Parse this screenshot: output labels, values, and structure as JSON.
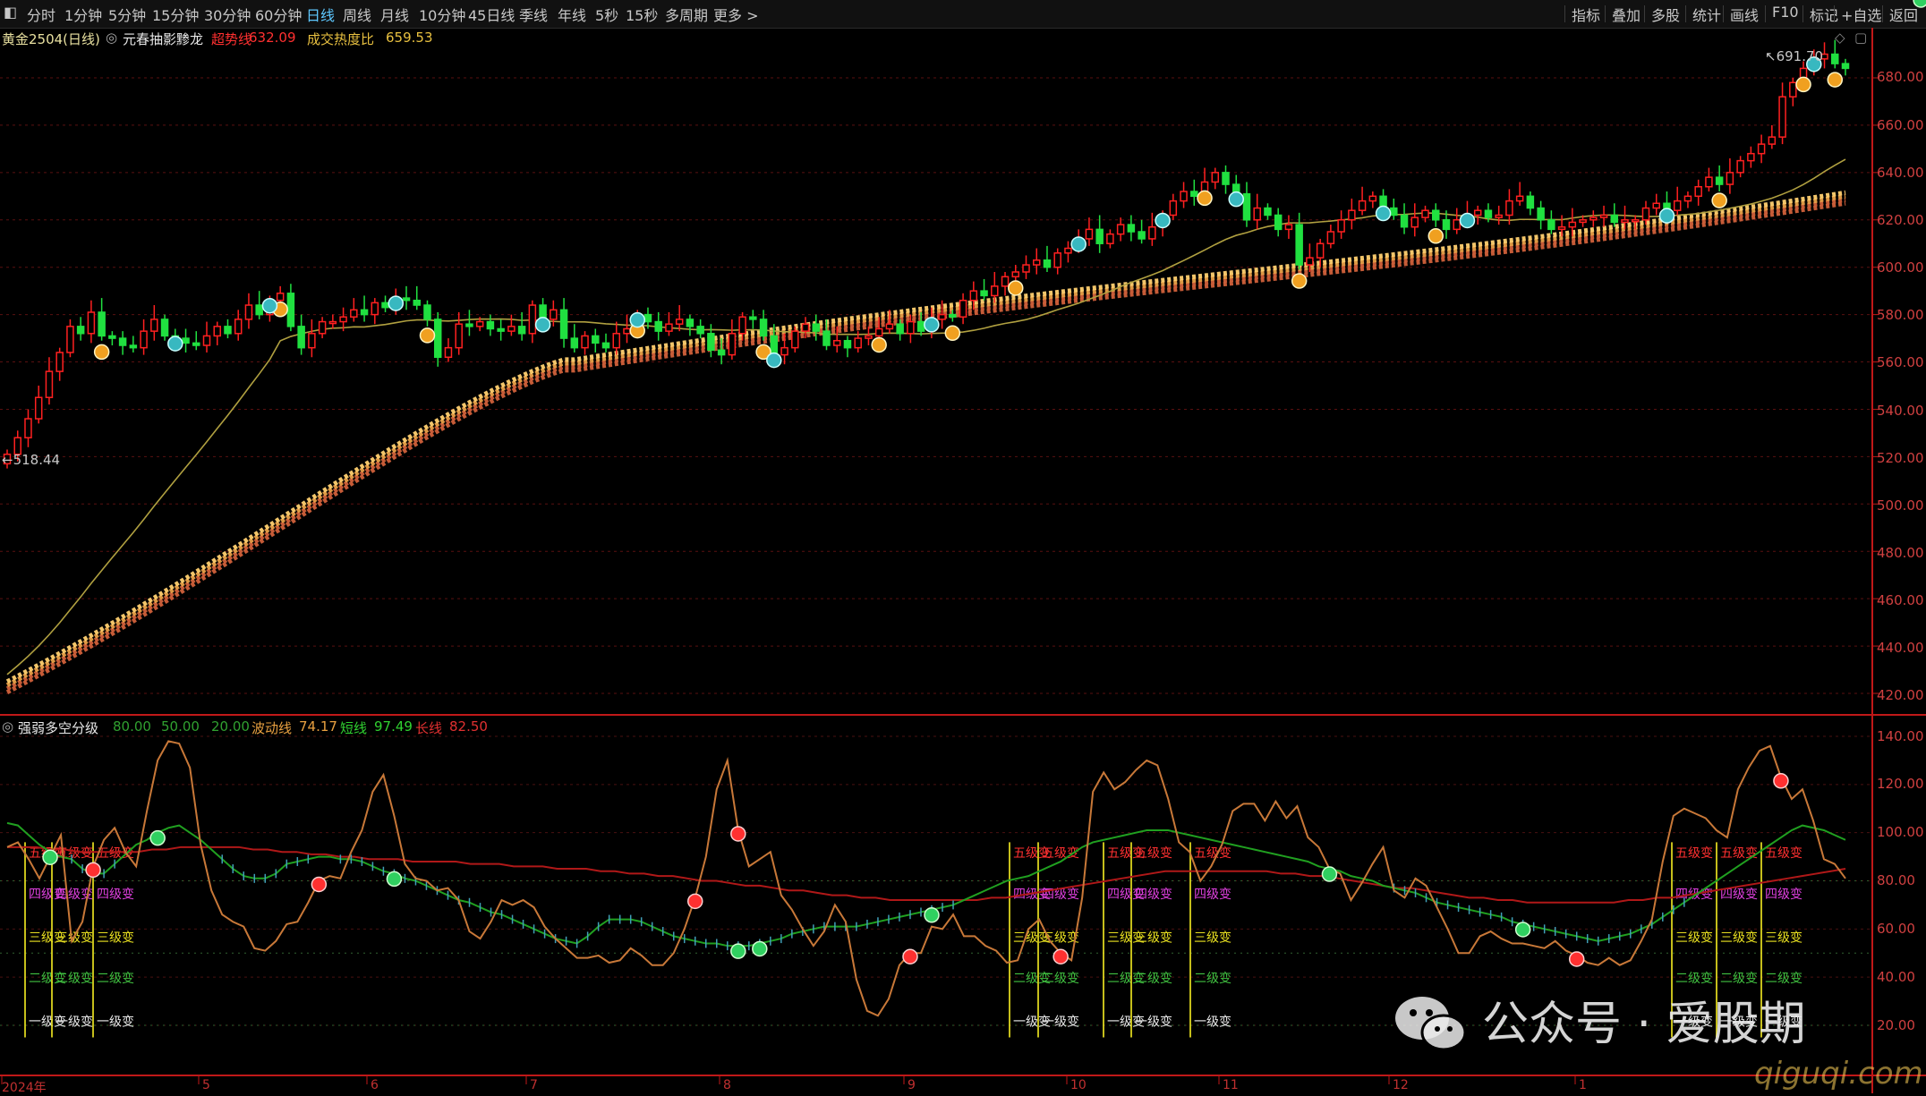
{
  "toolbar": {
    "periods": [
      "分时",
      "1分钟",
      "5分钟",
      "15分钟",
      "30分钟",
      "60分钟",
      "日线",
      "周线",
      "月线",
      "10分钟",
      "45日线",
      "季线",
      "年线",
      "5秒",
      "15秒",
      "多周期",
      "更多 >"
    ],
    "active_period": "日线",
    "right_items": [
      "指标",
      "叠加",
      "多股",
      "统计",
      "画线",
      "F10",
      "标记",
      "+自选",
      "返回"
    ]
  },
  "main_chart": {
    "symbol": "黄金2504(日线)",
    "indicator_name": "元春抽影黪龙",
    "ma_label": "超势线",
    "ma_value": "632.09",
    "volume_label": "成交热度比",
    "volume_value": "659.53",
    "price_high_label": "691.70",
    "price_low_label": "518.44",
    "y_ticks": [
      "680.00",
      "660.00",
      "640.00",
      "620.00",
      "600.00",
      "580.00",
      "560.00",
      "540.00",
      "520.00",
      "500.00",
      "480.00",
      "460.00",
      "440.00",
      "420.00"
    ]
  },
  "sub_chart": {
    "title": "强弱多空分级",
    "levels": [
      "80.00",
      "50.00",
      "20.00"
    ],
    "wave_label": "波动线",
    "wave_value": "74.17",
    "short_label": "短线",
    "short_value": "97.49",
    "long_label": "长线",
    "long_value": "82.50",
    "y_ticks": [
      "140.00",
      "120.00",
      "100.00",
      "80.00",
      "60.00",
      "40.00",
      "20.00"
    ],
    "grade_labels": [
      "五级变",
      "四级变",
      "三级变",
      "二级变",
      "一级变"
    ]
  },
  "x_axis": [
    "2024年",
    "5",
    "6",
    "7",
    "8",
    "9",
    "10",
    "11",
    "12",
    "1"
  ],
  "watermark": {
    "account": "公众号 · 爱股期",
    "url": "qiguqi.com"
  },
  "colors": {
    "up": "#ff2020",
    "down": "#20e040",
    "ma": "#b0a040",
    "band": "#e8a048",
    "wave": "#c87838",
    "short": "#20a020",
    "long": "#b01818",
    "cross": "#40a0b8",
    "axis_red": "#c01818"
  },
  "chart_data": [
    {
      "type": "candlestick",
      "title": "黄金2504(日线)",
      "x": [
        "2024年",
        "5",
        "6",
        "7",
        "8",
        "9",
        "10",
        "11",
        "12",
        "1"
      ],
      "ylim": [
        420,
        690
      ],
      "close": [
        521,
        528,
        536,
        545,
        556,
        564,
        575,
        572,
        581,
        571,
        570,
        567,
        566,
        573,
        578,
        571,
        570,
        568,
        567,
        571,
        575,
        572,
        578,
        584,
        580,
        586,
        589,
        575,
        566,
        572,
        577,
        577,
        579,
        582,
        580,
        585,
        583,
        587,
        586,
        584,
        578,
        562,
        566,
        576,
        575,
        577,
        574,
        573,
        575,
        572,
        584,
        578,
        582,
        570,
        566,
        571,
        568,
        566,
        572,
        574,
        580,
        577,
        573,
        576,
        578,
        575,
        572,
        565,
        563,
        572,
        579,
        578,
        571,
        563,
        566,
        573,
        576,
        573,
        567,
        569,
        566,
        570,
        571,
        574,
        576,
        572,
        577,
        573,
        578,
        580,
        579,
        586,
        590,
        588,
        592,
        596,
        598,
        601,
        603,
        600,
        606,
        608,
        612,
        616,
        610,
        614,
        618,
        615,
        612,
        617,
        622,
        628,
        632,
        630,
        636,
        640,
        635,
        631,
        620,
        625,
        622,
        616,
        618,
        601,
        604,
        610,
        615,
        620,
        624,
        628,
        630,
        625,
        622,
        617,
        621,
        624,
        620,
        616,
        620,
        622,
        624,
        621,
        622,
        628,
        630,
        625,
        620,
        616,
        617,
        619,
        620,
        621,
        622,
        619,
        620,
        620,
        625,
        627,
        624,
        628,
        630,
        634,
        638,
        635,
        640,
        645,
        648,
        652,
        655,
        672,
        678,
        684,
        688,
        690,
        686,
        684
      ]
    },
    {
      "type": "line",
      "title": "强弱多空分级",
      "ylim": [
        10,
        145
      ],
      "series": [
        {
          "name": "波动线",
          "values": [
            94,
            96,
            89,
            81,
            90,
            99,
            55,
            63,
            86,
            97,
            102,
            92,
            86,
            109,
            130,
            138,
            137,
            127,
            95,
            76,
            66,
            63,
            61,
            52,
            51,
            55,
            62,
            63,
            71,
            80,
            82,
            81,
            92,
            101,
            117,
            124,
            107,
            87,
            81,
            80,
            76,
            77,
            72,
            59,
            56,
            63,
            72,
            70,
            72,
            69,
            61,
            56,
            52,
            48,
            48,
            49,
            46,
            47,
            52,
            49,
            45,
            45,
            50,
            60,
            73,
            90,
            118,
            130,
            101,
            86,
            89,
            92,
            74,
            68,
            60,
            53,
            59,
            70,
            63,
            39,
            26,
            24,
            31,
            45,
            50,
            50,
            61,
            60,
            66,
            57,
            57,
            53,
            51,
            46,
            47,
            60,
            64,
            55,
            50,
            47,
            73,
            117,
            125,
            118,
            121,
            126,
            130,
            128,
            114,
            96,
            92,
            80,
            86,
            95,
            109,
            112,
            112,
            105,
            113,
            106,
            111,
            98,
            94,
            85,
            83,
            72,
            79,
            87,
            94,
            76,
            73,
            81,
            78,
            69,
            60,
            50,
            50,
            57,
            59,
            56,
            54,
            54,
            53,
            52,
            55,
            51,
            49,
            46,
            45,
            48,
            45,
            47,
            55,
            64,
            88,
            107,
            110,
            108,
            106,
            101,
            98,
            118,
            127,
            134,
            136,
            123,
            114,
            118,
            105,
            89,
            87,
            81
          ]
        },
        {
          "name": "短线",
          "values": [
            104,
            103,
            99,
            95,
            92,
            90,
            89,
            85,
            83,
            83,
            87,
            91,
            95,
            97,
            100,
            102,
            103,
            100,
            97,
            93,
            89,
            85,
            82,
            81,
            81,
            83,
            87,
            88,
            89,
            90,
            90,
            89,
            89,
            88,
            86,
            84,
            83,
            81,
            80,
            78,
            76,
            74,
            72,
            71,
            69,
            67,
            66,
            64,
            62,
            60,
            58,
            56,
            55,
            54,
            57,
            61,
            64,
            64,
            64,
            63,
            61,
            59,
            57,
            56,
            55,
            54,
            54,
            53,
            53,
            53,
            54,
            55,
            56,
            58,
            59,
            60,
            61,
            61,
            61,
            61,
            62,
            63,
            64,
            65,
            66,
            67,
            68,
            69,
            70,
            72,
            74,
            76,
            78,
            80,
            81,
            82,
            84,
            86,
            88,
            91,
            94,
            96,
            97,
            98,
            99,
            100,
            101,
            101,
            101,
            100,
            99,
            98,
            97,
            96,
            95,
            94,
            93,
            92,
            91,
            90,
            89,
            88,
            86,
            85,
            84,
            82,
            81,
            80,
            78,
            77,
            76,
            75,
            73,
            71,
            70,
            69,
            68,
            67,
            66,
            65,
            63,
            62,
            61,
            60,
            59,
            58,
            57,
            56,
            55,
            56,
            57,
            58,
            60,
            62,
            65,
            68,
            71,
            74,
            77,
            80,
            83,
            86,
            89,
            92,
            95,
            98,
            101,
            103,
            102,
            101,
            99,
            97
          ]
        },
        {
          "name": "长线",
          "values": [
            94,
            94,
            94,
            93,
            93,
            92,
            92,
            92,
            92,
            92,
            93,
            93,
            94,
            94,
            94,
            94,
            94,
            93,
            93,
            92,
            92,
            91,
            91,
            90,
            90,
            89,
            89,
            89,
            88,
            88,
            88,
            88,
            87,
            87,
            87,
            86,
            86,
            86,
            85,
            85,
            85,
            84,
            84,
            83,
            83,
            82,
            82,
            81,
            80,
            80,
            79,
            78,
            78,
            77,
            76,
            76,
            75,
            74,
            74,
            73,
            73,
            72,
            72,
            72,
            72,
            72,
            72,
            72,
            73,
            73,
            74,
            75,
            76,
            77,
            78,
            79,
            80,
            81,
            82,
            83,
            84,
            84,
            84,
            84,
            84,
            84,
            84,
            84,
            83,
            83,
            82,
            82,
            81,
            80,
            79,
            78,
            77,
            77,
            76,
            75,
            74,
            73,
            73,
            72,
            72,
            71,
            71,
            71,
            71,
            71,
            71,
            71,
            72,
            72,
            73,
            73,
            74,
            75,
            76,
            77,
            78,
            79,
            80,
            81,
            82,
            83,
            84,
            85
          ]
        }
      ]
    }
  ]
}
